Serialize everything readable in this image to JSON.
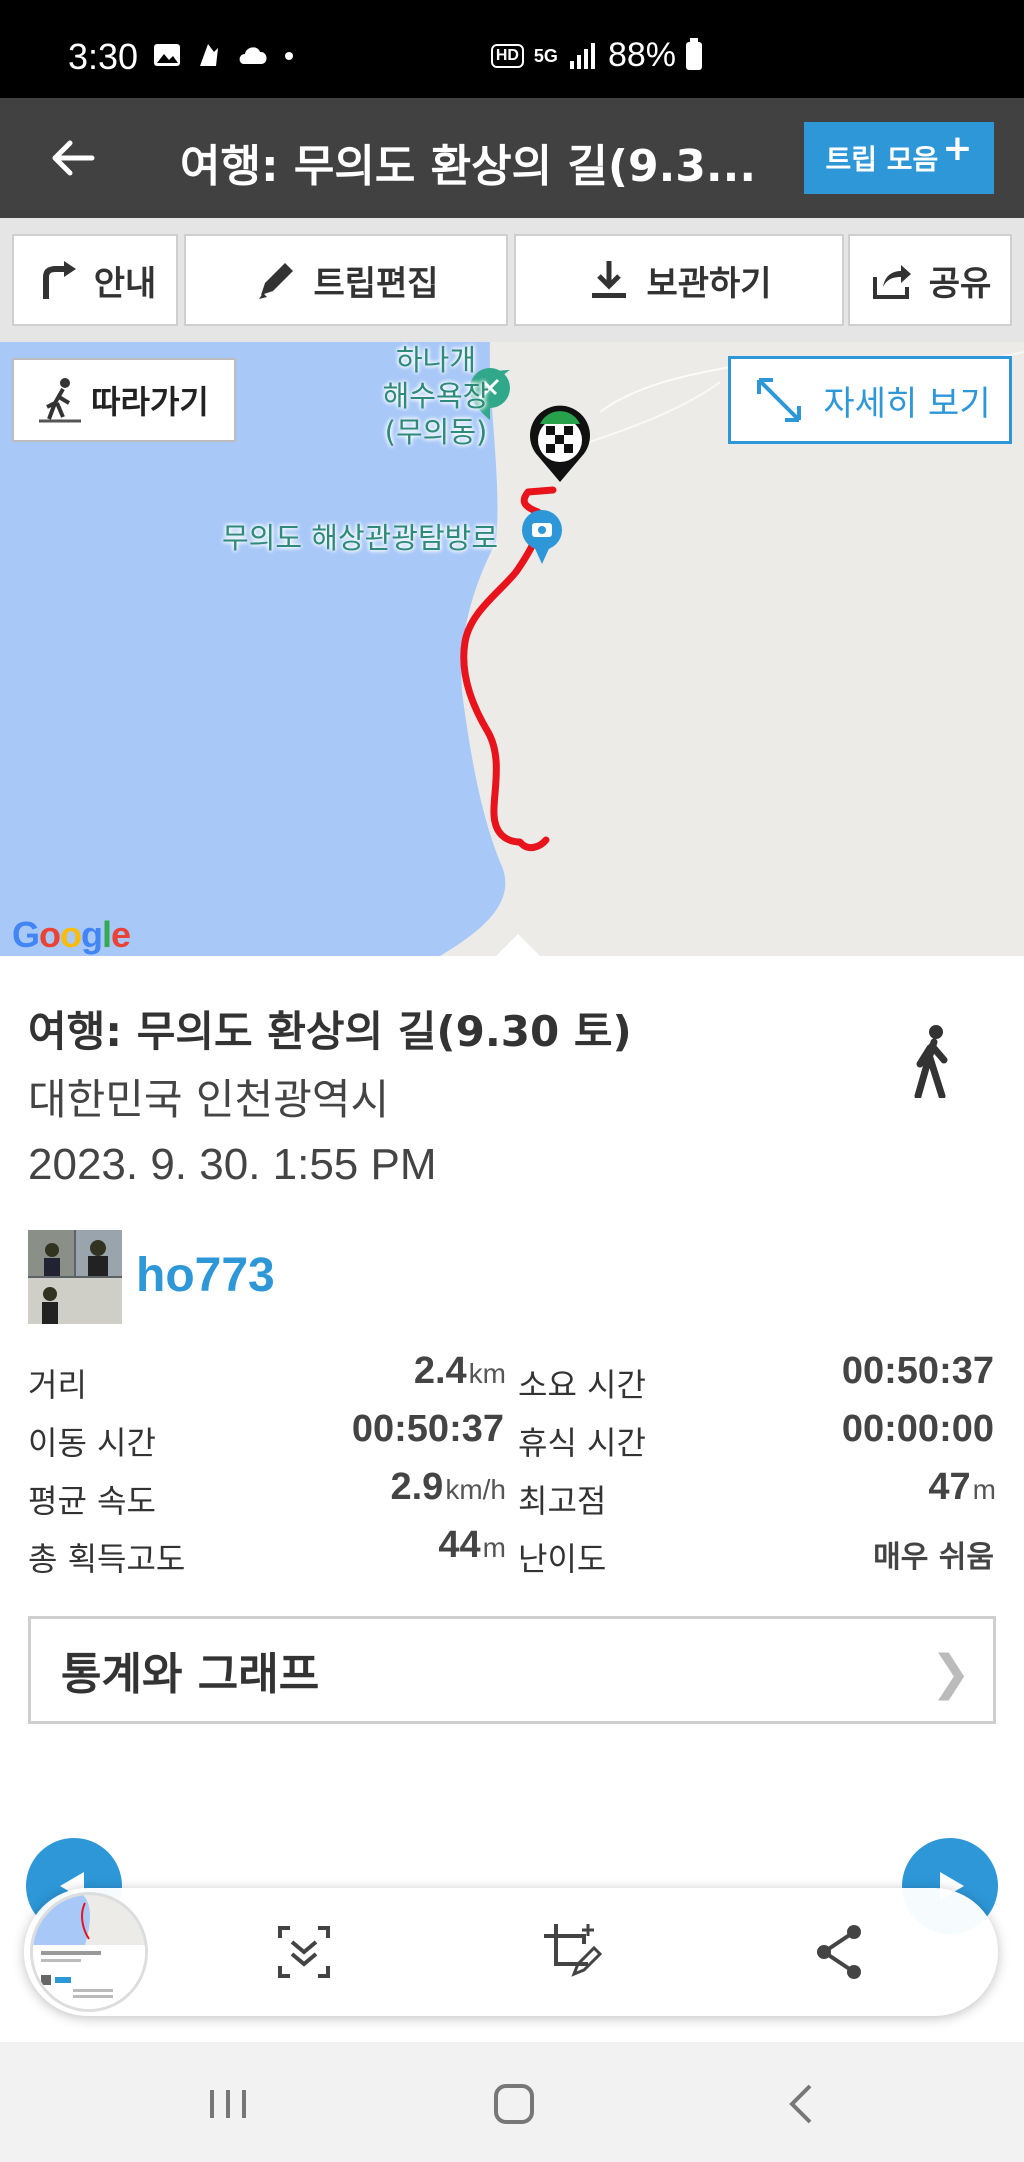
{
  "status_bar": {
    "time": "3:30",
    "hd_badge": "HD",
    "network": "5G",
    "battery_percent": "88%"
  },
  "header": {
    "title": "여행: 무의도 환상의 길(9.3...",
    "trip_collection_label": "트립 모음",
    "trip_collection_plus": "+"
  },
  "toolbar": {
    "guide_label": "안내",
    "edit_trip_label": "트립편집",
    "save_label": "보관하기",
    "share_label": "공유"
  },
  "map": {
    "follow_label": "따라가기",
    "view_detail_label": "자세히 보기",
    "beach_label": "하나개\n해수욕장\n(무의동)",
    "beach_line1": "하나개",
    "beach_line2": "해수욕장",
    "beach_line3": "(무의동)",
    "trail_label": "무의도 해상관광탐방로",
    "google_logo": "Google",
    "colors": {
      "sea": "#a8c8f8",
      "land": "#ecebe8",
      "track": "#e8131b",
      "poi": "#32a88a"
    }
  },
  "trip": {
    "title": "여행: 무의도 환상의 길(9.30 토)",
    "location": "대한민국 인천광역시",
    "datetime": "2023. 9. 30. 1:55 PM",
    "username": "ho773",
    "activity_icon": "walking-icon"
  },
  "stats": {
    "rows": [
      {
        "label1": "거리",
        "value1": "2.4",
        "unit1": "km",
        "label2": "소요 시간",
        "value2": "00:50:37",
        "unit2": ""
      },
      {
        "label1": "이동 시간",
        "value1": "00:50:37",
        "unit1": "",
        "label2": "휴식 시간",
        "value2": "00:00:00",
        "unit2": ""
      },
      {
        "label1": "평균 속도",
        "value1": "2.9",
        "unit1": "km/h",
        "label2": "최고점",
        "value2": "47",
        "unit2": "m"
      },
      {
        "label1": "총 획득고도",
        "value1": "44",
        "unit1": "m",
        "label2": "난이도",
        "value2": "매우 쉬움",
        "unit2": ""
      }
    ]
  },
  "graph_button": {
    "label": "통계와 그래프",
    "chevron": "❯"
  },
  "colors": {
    "accent": "#2d97d8",
    "header_bg": "#414141",
    "toolbar_bg": "#e5e5e5"
  }
}
